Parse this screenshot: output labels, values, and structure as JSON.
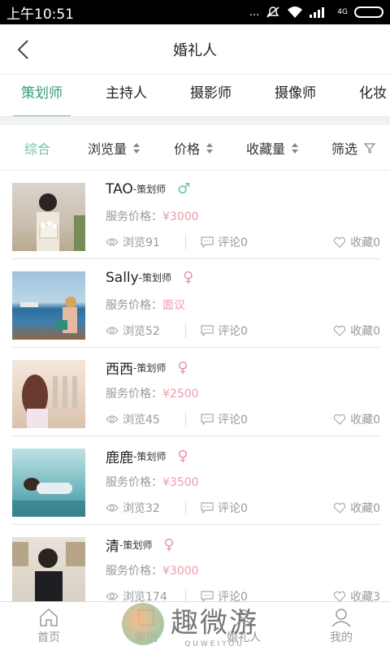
{
  "status_bar": {
    "time": "上午10:51",
    "signal_dots": "...",
    "net_label": "4G"
  },
  "header": {
    "title": "婚礼人"
  },
  "tabs": [
    {
      "label": "策划师",
      "active": true
    },
    {
      "label": "主持人",
      "active": false
    },
    {
      "label": "摄影师",
      "active": false
    },
    {
      "label": "摄像师",
      "active": false
    },
    {
      "label": "化妆",
      "active": false
    }
  ],
  "filters": [
    {
      "label": "综合",
      "active": true
    },
    {
      "label": "浏览量"
    },
    {
      "label": "价格"
    },
    {
      "label": "收藏量"
    },
    {
      "label": "筛选"
    }
  ],
  "labels": {
    "price_prefix": "服务价格："
  },
  "items": [
    {
      "name": "TAO",
      "role": "-策划师",
      "gender": "♂",
      "price": "¥3000",
      "views": "浏览91",
      "comments": "评论0",
      "favs": "收藏0"
    },
    {
      "name": "Sally",
      "role": "-策划师",
      "gender": "♀",
      "price": "面议",
      "views": "浏览52",
      "comments": "评论0",
      "favs": "收藏0"
    },
    {
      "name": "西西",
      "role": "-策划师",
      "gender": "♀",
      "price": "¥2500",
      "views": "浏览45",
      "comments": "评论0",
      "favs": "收藏0"
    },
    {
      "name": "鹿鹿",
      "role": "-策划师",
      "gender": "♀",
      "price": "¥3500",
      "views": "浏览32",
      "comments": "评论0",
      "favs": "收藏0"
    },
    {
      "name": "清",
      "role": "-策划师",
      "gender": "♀",
      "price": "¥3000",
      "views": "浏览174",
      "comments": "评论0",
      "favs": "收藏3"
    }
  ],
  "bottom_nav": [
    {
      "label": "首页",
      "icon": "home-icon"
    },
    {
      "label": "案例",
      "icon": "cases-icon"
    },
    {
      "label": "婚礼人",
      "icon": "people-icon"
    },
    {
      "label": "我的",
      "icon": "user-icon"
    }
  ],
  "watermark": {
    "main": "趣微游",
    "sub": "QUWEIYOU"
  },
  "colors": {
    "accent": "#6fc3a6",
    "price": "#f09aa8",
    "female": "#e895a8",
    "male": "#6fc3a6"
  }
}
